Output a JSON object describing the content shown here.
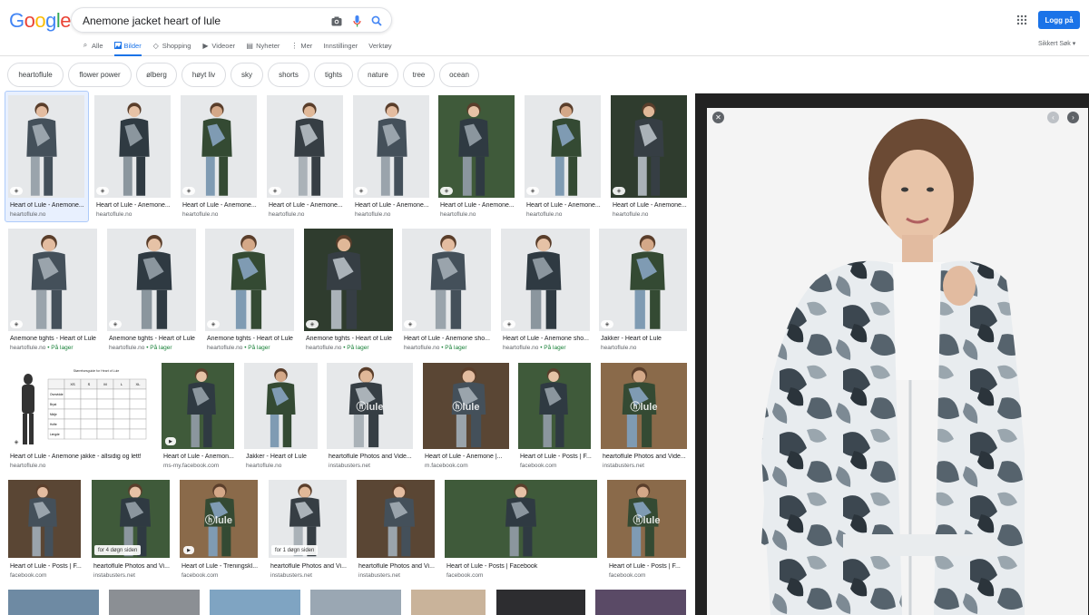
{
  "logo": "Google",
  "search": {
    "value": "Anemone jacket heart of lule"
  },
  "tabs": [
    {
      "label": "Alle",
      "icon": "search-icon"
    },
    {
      "label": "Bilder",
      "icon": "image-icon",
      "active": true
    },
    {
      "label": "Shopping",
      "icon": "tag-icon"
    },
    {
      "label": "Videoer",
      "icon": "play-icon"
    },
    {
      "label": "Nyheter",
      "icon": "news-icon"
    },
    {
      "label": "Mer",
      "icon": "more-icon"
    },
    {
      "label": "Innstillinger",
      "icon": ""
    },
    {
      "label": "Verktøy",
      "icon": ""
    }
  ],
  "login_label": "Logg på",
  "safe_search": "Sikkert Søk ▾",
  "chips": [
    "heartoflule",
    "flower power",
    "ølberg",
    "høyt liv",
    "sky",
    "shorts",
    "tights",
    "nature",
    "tree",
    "ocean"
  ],
  "rows": [
    [
      {
        "title": "Heart of Lule - Anemone...",
        "domain": "heartoflule.no",
        "stock": ""
      },
      {
        "title": "Heart of Lule - Anemone...",
        "domain": "heartoflule.no",
        "stock": ""
      },
      {
        "title": "Heart of Lule - Anemone...",
        "domain": "heartoflule.no",
        "stock": ""
      },
      {
        "title": "Heart of Lule - Anemone...",
        "domain": "heartoflule.no",
        "stock": ""
      },
      {
        "title": "Heart of Lule - Anemone...",
        "domain": "heartoflule.no",
        "stock": ""
      },
      {
        "title": "Heart of Lule - Anemone...",
        "domain": "heartoflule.no",
        "stock": ""
      },
      {
        "title": "Heart of Lule - Anemone...",
        "domain": "heartoflule.no",
        "stock": ""
      },
      {
        "title": "Heart of Lule - Anemone...",
        "domain": "heartoflule.no",
        "stock": ""
      }
    ],
    [
      {
        "title": "Anemone tights - Heart of Lule",
        "domain": "heartoflule.no",
        "stock": "På lager"
      },
      {
        "title": "Anemone tights - Heart of Lule",
        "domain": "heartoflule.no",
        "stock": "På lager"
      },
      {
        "title": "Anemone tights - Heart of Lule",
        "domain": "heartoflule.no",
        "stock": "På lager"
      },
      {
        "title": "Anemone tights - Heart of Lule",
        "domain": "heartoflule.no",
        "stock": "På lager"
      },
      {
        "title": "Heart of Lule - Anemone sho...",
        "domain": "heartoflule.no",
        "stock": "På lager"
      },
      {
        "title": "Heart of Lule - Anemone sho...",
        "domain": "heartoflule.no",
        "stock": "På lager"
      },
      {
        "title": "Jakker - Heart of Lule",
        "domain": "heartoflule.no",
        "stock": ""
      }
    ],
    [
      {
        "title": "Heart of Lule - Anemone jakke - allsidig og lett!",
        "domain": "heartoflule.no",
        "stock": ""
      },
      {
        "title": "Heart of Lule - Anemon...",
        "domain": "ms-my.facebook.com",
        "stock": ""
      },
      {
        "title": "Jakker - Heart of Lule",
        "domain": "heartoflule.no",
        "stock": ""
      },
      {
        "title": "heartoflule Photos and Vide...",
        "domain": "instabusters.net",
        "stock": ""
      },
      {
        "title": "Heart of Lule - Anemone |...",
        "domain": "m.facebook.com",
        "stock": ""
      },
      {
        "title": "Heart of Lule - Posts | F...",
        "domain": "facebook.com",
        "stock": ""
      },
      {
        "title": "heartoflule Photos and Vide...",
        "domain": "instabusters.net",
        "stock": ""
      }
    ],
    [
      {
        "title": "Heart of Lule - Posts | F...",
        "domain": "facebook.com",
        "stock": ""
      },
      {
        "title": "heartoflule Photos and Vi...",
        "domain": "instabusters.net",
        "stock": ""
      },
      {
        "title": "Heart of Lule - Treningskl...",
        "domain": "facebook.com",
        "stock": ""
      },
      {
        "title": "heartoflule Photos and Vi...",
        "domain": "instabusters.net",
        "stock": ""
      },
      {
        "title": "heartoflule Photos and Vi...",
        "domain": "instabusters.net",
        "stock": ""
      },
      {
        "title": "Heart of Lule - Posts | Facebook",
        "domain": "facebook.com",
        "stock": ""
      },
      {
        "title": "Heart of Lule - Posts | F...",
        "domain": "facebook.com",
        "stock": ""
      }
    ]
  ],
  "badges": {
    "ago4": "for 4 døgn siden",
    "ago1": "for 1 døgn siden",
    "watermark": "lule"
  },
  "size_table": {
    "title": "Størrelsesguide for Heart of Lule",
    "headers": [
      "",
      "XS",
      "S",
      "M",
      "L",
      "XL"
    ],
    "rows": [
      [
        "Overvidde",
        "",
        "",
        "",
        "",
        ""
      ],
      [
        "Bryst",
        "",
        "",
        "",
        "",
        ""
      ],
      [
        "Midje",
        "",
        "",
        "",
        "",
        ""
      ],
      [
        "Hofte",
        "",
        "",
        "",
        "",
        ""
      ],
      [
        "Lengde",
        "",
        "",
        "",
        "",
        ""
      ]
    ]
  },
  "colors": {
    "accent": "#1a73e8",
    "stock": "#188038",
    "panel_bg": "#222222"
  }
}
